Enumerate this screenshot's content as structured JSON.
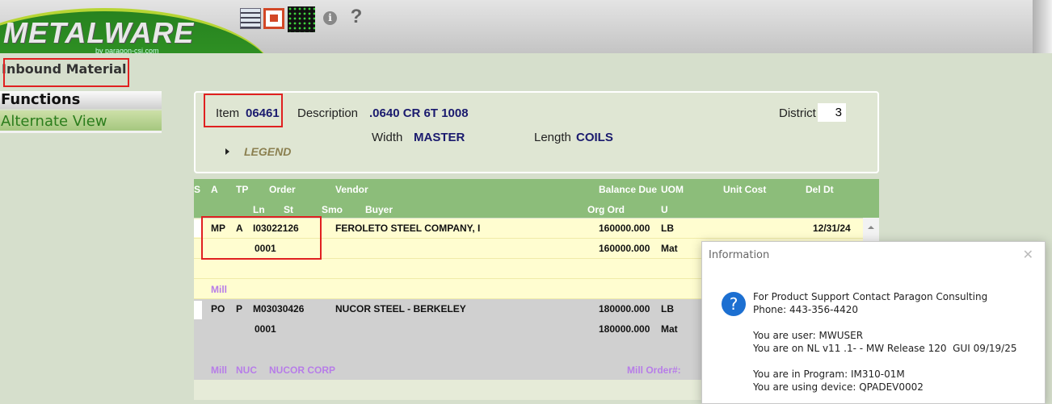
{
  "header": {
    "logo_text": "METALWARE",
    "logo_sub": "by paragon-csi.com",
    "toolbar": [
      "calculator-icon",
      "powerpoint-icon",
      "grid-icon",
      "info-icon",
      "help-icon"
    ]
  },
  "page": {
    "title": "Inbound Material"
  },
  "menu": {
    "functions": "Functions",
    "alternate_view": "Alternate View"
  },
  "item": {
    "item_label": "Item",
    "item_value": "06461",
    "desc_label": "Description",
    "desc_value": ".0640 CR 6T  1008",
    "district_label": "District",
    "district_value": "3",
    "width_label": "Width",
    "width_value": "MASTER",
    "length_label": "Length",
    "length_value": "COILS",
    "legend": "LEGEND"
  },
  "grid": {
    "headers_row1": {
      "s": "S",
      "a": "A",
      "tp": "TP",
      "order": "Order",
      "vendor": "Vendor",
      "balance": "Balance Due",
      "uom": "UOM",
      "unit_cost": "Unit Cost",
      "del_dt": "Del Dt"
    },
    "headers_row2": {
      "ln": "Ln",
      "st": "St",
      "smo": "Smo",
      "buyer": "Buyer",
      "org_ord": "Org Ord",
      "u": "U"
    },
    "records": [
      {
        "tp": "MP",
        "st": "A",
        "order": "I03022126",
        "vendor": "FEROLETO STEEL COMPANY, I",
        "balance": "160000.000",
        "uom": "LB",
        "del_dt": "12/31/24",
        "ln": "0001",
        "org_ord": "160000.000",
        "u": "Mat",
        "mill_label": "Mill"
      },
      {
        "tp": "PO",
        "st": "P",
        "order": "M03030426",
        "vendor": "NUCOR STEEL - BERKELEY",
        "balance": "180000.000",
        "uom": "LB",
        "ln": "0001",
        "org_ord": "180000.000",
        "u": "Mat",
        "mill_label": "Mill",
        "mill_code": "NUC",
        "mill_name": "NUCOR CORP",
        "mill_order_label": "Mill Order#:"
      }
    ]
  },
  "dialog": {
    "title": "Information",
    "lines": [
      "For Product Support Contact Paragon Consulting",
      "Phone: 443-356-4420",
      "You are user: MWUSER",
      "You are on NL v11 .1- - MW Release 120  GUI 09/19/25",
      "You are in Program: IM310-01M",
      "You are using device: QPADEV0002"
    ]
  }
}
